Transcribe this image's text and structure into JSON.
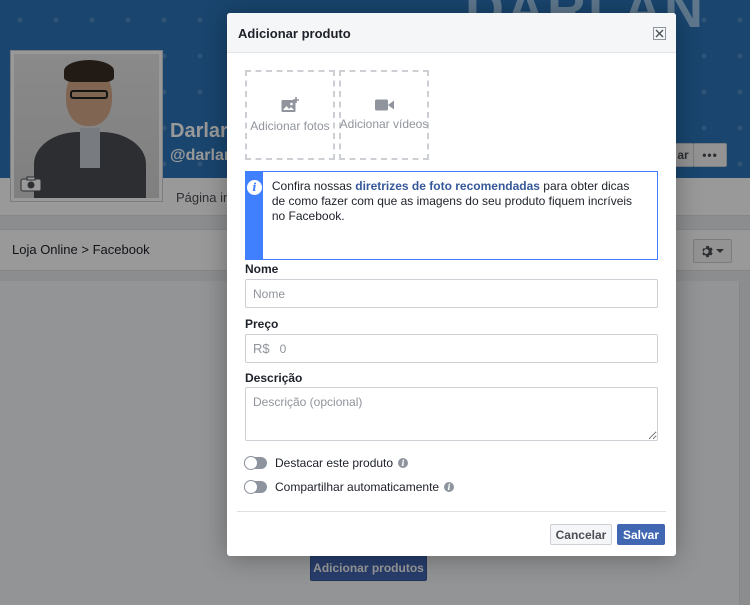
{
  "background": {
    "cover": {
      "brand_text": "DARLAN",
      "name_fragment": "Darlar",
      "handle_fragment": "@darlar",
      "button_fragment": "ar",
      "more_label": "•••"
    },
    "profile_bar": {
      "tab_fragment": "Página in"
    },
    "content_row": {
      "breadcrumb": "Loja Online > Facebook"
    },
    "add_products_label": "Adicionar produtos"
  },
  "modal": {
    "title": "Adicionar produto",
    "media": {
      "add_photos": "Adicionar fotos",
      "add_videos": "Adicionar vídeos"
    },
    "info": {
      "text_before": "Confira nossas ",
      "link": "diretrizes de foto recomendadas",
      "text_after": " para obter dicas de como fazer com que as imagens do seu produto fiquem incríveis no Facebook."
    },
    "fields": {
      "name_label": "Nome",
      "name_placeholder": "Nome",
      "price_label": "Preço",
      "price_currency": "R$",
      "price_placeholder": "0",
      "description_label": "Descrição",
      "description_placeholder": "Descrição (opcional)"
    },
    "toggles": {
      "feature_label": "Destacar este produto",
      "share_label": "Compartilhar automaticamente"
    },
    "buttons": {
      "cancel": "Cancelar",
      "save": "Salvar"
    }
  },
  "colors": {
    "brand_blue": "#4267b2",
    "info_blue": "#4080ff",
    "link_blue": "#365899",
    "cover_blue": "#2a73b8"
  },
  "icons": {
    "photo": "add-photo-icon",
    "video": "video-camera-icon",
    "info": "info-icon",
    "help": "help-icon",
    "close": "close-icon",
    "camera": "camera-icon",
    "gear": "gear-icon"
  }
}
